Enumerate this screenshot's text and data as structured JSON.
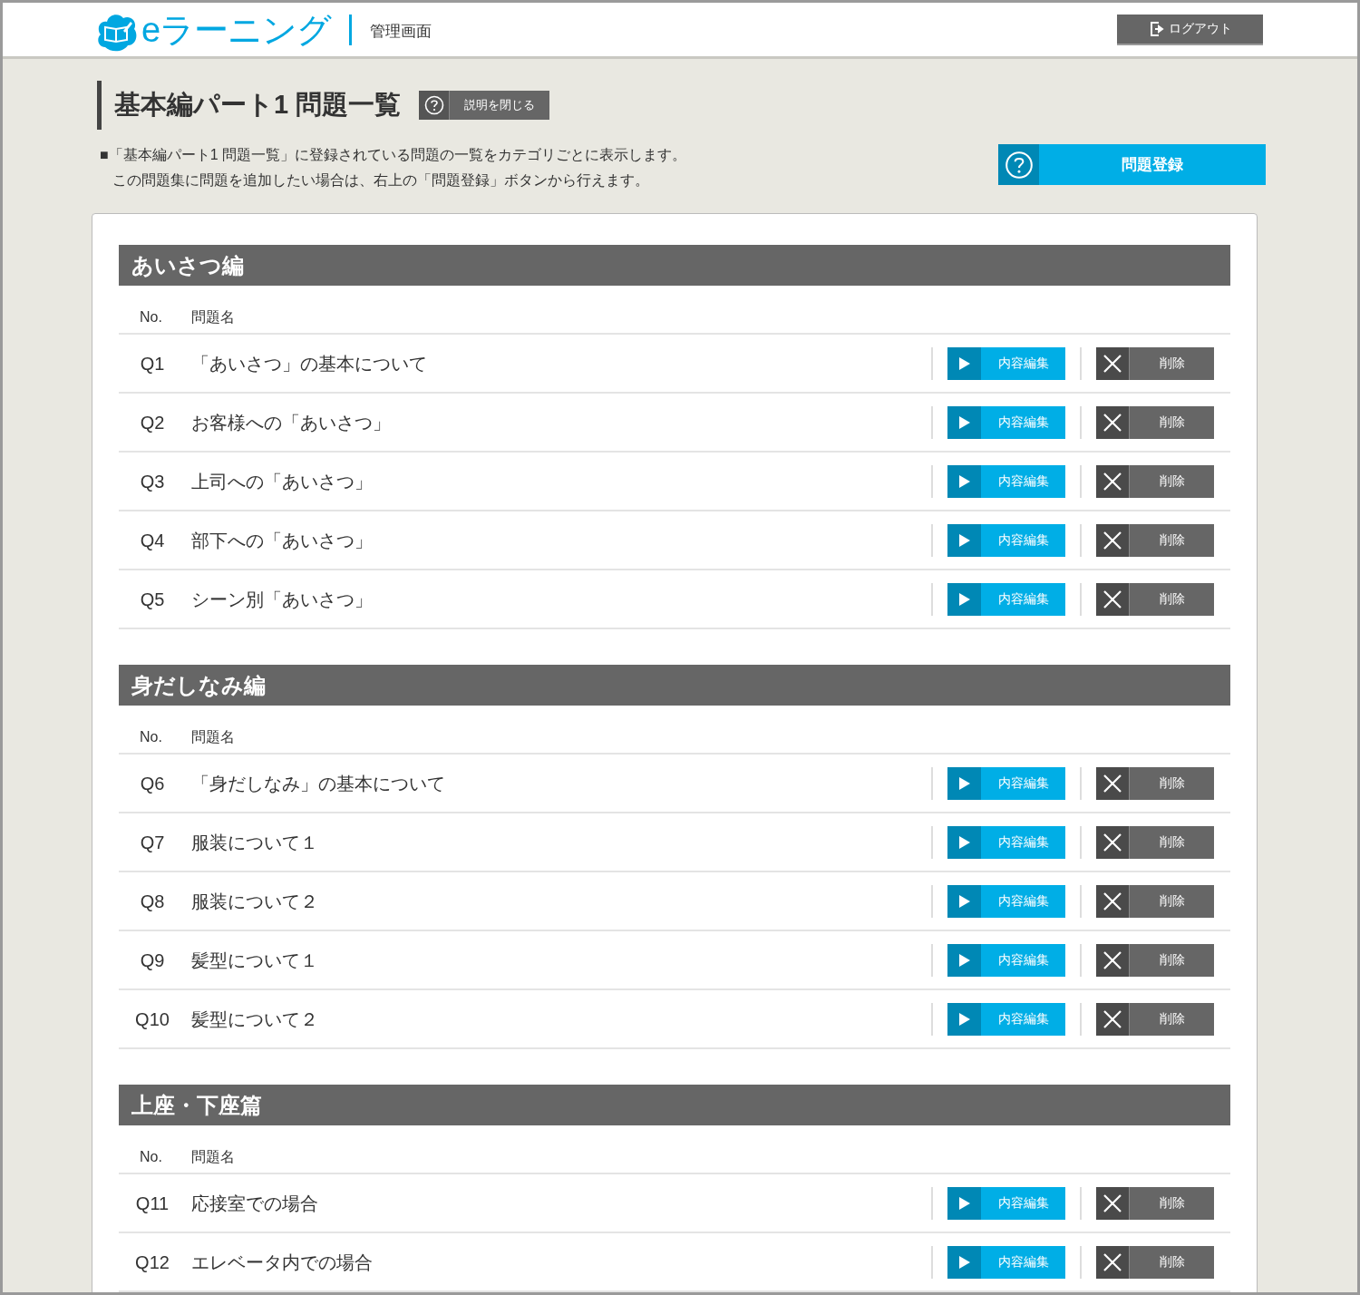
{
  "header": {
    "logo_text": "eラーニング",
    "subtitle": "管理画面",
    "logout_button": "ログアウト"
  },
  "page": {
    "title": "基本編パート1 問題一覧",
    "help_toggle_button": "説明を閉じる",
    "description": [
      "■「基本編パート1 問題一覧」に登録されている問題の一覧をカテゴリごとに表示します。",
      "この問題集に問題を追加したい場合は、右上の「問題登録」ボタンから行えます。"
    ],
    "register_button": "問題登録"
  },
  "sections": [
    {
      "title": "あいさつ編",
      "columns": [
        "No.",
        "問題名"
      ],
      "rows": [
        {
          "no": "Q1",
          "name": "「あいさつ」の基本について",
          "edit_button": "内容編集",
          "delete_button": "削除"
        },
        {
          "no": "Q2",
          "name": "お客様への「あいさつ」",
          "edit_button": "内容編集",
          "delete_button": "削除"
        },
        {
          "no": "Q3",
          "name": "上司への「あいさつ」",
          "edit_button": "内容編集",
          "delete_button": "削除"
        },
        {
          "no": "Q4",
          "name": "部下への「あいさつ」",
          "edit_button": "内容編集",
          "delete_button": "削除"
        },
        {
          "no": "Q5",
          "name": "シーン別「あいさつ」",
          "edit_button": "内容編集",
          "delete_button": "削除"
        }
      ]
    },
    {
      "title": "身だしなみ編",
      "columns": [
        "No.",
        "問題名"
      ],
      "rows": [
        {
          "no": "Q6",
          "name": "「身だしなみ」の基本について",
          "edit_button": "内容編集",
          "delete_button": "削除"
        },
        {
          "no": "Q7",
          "name": "服装について１",
          "edit_button": "内容編集",
          "delete_button": "削除"
        },
        {
          "no": "Q8",
          "name": "服装について２",
          "edit_button": "内容編集",
          "delete_button": "削除"
        },
        {
          "no": "Q9",
          "name": "髪型について１",
          "edit_button": "内容編集",
          "delete_button": "削除"
        },
        {
          "no": "Q10",
          "name": "髪型について２",
          "edit_button": "内容編集",
          "delete_button": "削除"
        }
      ]
    },
    {
      "title": "上座・下座篇",
      "columns": [
        "No.",
        "問題名"
      ],
      "rows": [
        {
          "no": "Q11",
          "name": "応接室での場合",
          "edit_button": "内容編集",
          "delete_button": "削除"
        },
        {
          "no": "Q12",
          "name": "エレベータ内での場合",
          "edit_button": "内容編集",
          "delete_button": "削除"
        }
      ]
    }
  ]
}
